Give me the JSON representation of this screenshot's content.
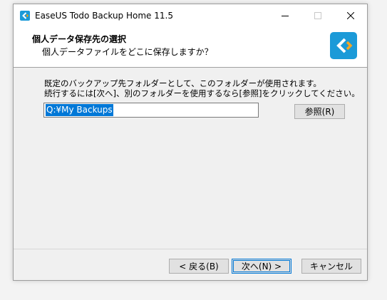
{
  "window": {
    "title": "EaseUS Todo Backup Home 11.5"
  },
  "header": {
    "title": "個人データ保存先の選択",
    "subtitle": "個人データファイルをどこに保存しますか？"
  },
  "content": {
    "line1": "既定のバックアップ先フォルダーとして、このフォルダーが使用されます。",
    "line2": "続行するには[次へ]、別のフォルダーを使用するなら[参照]をクリックしてください。",
    "path_value": "Q:¥My Backups",
    "browse_label": "参照(R)"
  },
  "footer": {
    "back_label": "< 戻る(B)",
    "next_label": "次へ(N) >",
    "cancel_label": "キャンセル"
  },
  "colors": {
    "brand": "#1b9ad8",
    "selection": "#0078d7"
  }
}
